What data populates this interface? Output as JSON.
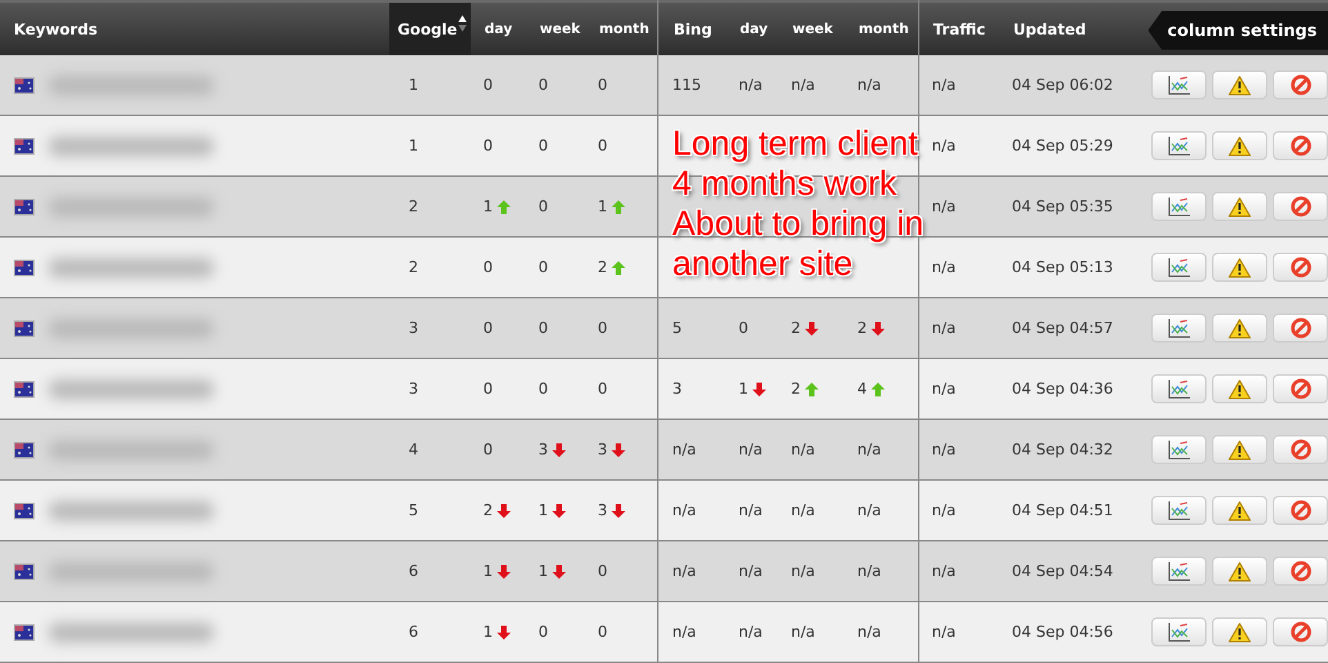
{
  "header": {
    "columns": [
      {
        "label": "Keywords",
        "selected": false
      },
      {
        "label": "Google",
        "selected": true
      },
      {
        "label": "day",
        "selected": false
      },
      {
        "label": "week",
        "selected": false
      },
      {
        "label": "month",
        "selected": false
      },
      {
        "label": "Bing",
        "selected": false
      },
      {
        "label": "day",
        "selected": false
      },
      {
        "label": "week",
        "selected": false
      },
      {
        "label": "month",
        "selected": false
      },
      {
        "label": "Traffic",
        "selected": false
      },
      {
        "label": "Updated",
        "selected": false
      }
    ],
    "settings_button": "column settings"
  },
  "rows": [
    {
      "google": "1",
      "google_changes": [
        {
          "value": "0",
          "up": false,
          "down": false
        },
        {
          "value": "0",
          "up": false,
          "down": false
        },
        {
          "value": "0",
          "up": false,
          "down": false
        }
      ],
      "bing": "115",
      "bing_changes": [
        {
          "value": "n/a",
          "up": false,
          "down": false
        },
        {
          "value": "n/a",
          "up": false,
          "down": false
        },
        {
          "value": "n/a",
          "up": false,
          "down": false
        }
      ],
      "traffic": "n/a",
      "updated": "04 Sep 06:02"
    },
    {
      "google": "1",
      "google_changes": [
        {
          "value": "0",
          "up": false,
          "down": false
        },
        {
          "value": "0",
          "up": false,
          "down": false
        },
        {
          "value": "0",
          "up": false,
          "down": false
        }
      ],
      "traffic": "n/a",
      "updated": "04 Sep 05:29"
    },
    {
      "google": "2",
      "google_changes": [
        {
          "value": "1",
          "up": true,
          "down": false
        },
        {
          "value": "0",
          "up": false,
          "down": false
        },
        {
          "value": "1",
          "up": true,
          "down": false
        }
      ],
      "traffic": "n/a",
      "updated": "04 Sep 05:35"
    },
    {
      "google": "2",
      "google_changes": [
        {
          "value": "0",
          "up": false,
          "down": false
        },
        {
          "value": "0",
          "up": false,
          "down": false
        },
        {
          "value": "2",
          "up": true,
          "down": false
        }
      ],
      "traffic": "n/a",
      "updated": "04 Sep 05:13"
    },
    {
      "google": "3",
      "google_changes": [
        {
          "value": "0",
          "up": false,
          "down": false
        },
        {
          "value": "0",
          "up": false,
          "down": false
        },
        {
          "value": "0",
          "up": false,
          "down": false
        }
      ],
      "bing": "5",
      "bing_changes": [
        {
          "value": "0",
          "up": false,
          "down": false
        },
        {
          "value": "2",
          "up": false,
          "down": true
        },
        {
          "value": "2",
          "up": false,
          "down": true
        }
      ],
      "traffic": "n/a",
      "updated": "04 Sep 04:57"
    },
    {
      "google": "3",
      "google_changes": [
        {
          "value": "0",
          "up": false,
          "down": false
        },
        {
          "value": "0",
          "up": false,
          "down": false
        },
        {
          "value": "0",
          "up": false,
          "down": false
        }
      ],
      "bing": "3",
      "bing_changes": [
        {
          "value": "1",
          "up": false,
          "down": true
        },
        {
          "value": "2",
          "up": true,
          "down": false
        },
        {
          "value": "4",
          "up": true,
          "down": false
        }
      ],
      "traffic": "n/a",
      "updated": "04 Sep 04:36"
    },
    {
      "google": "4",
      "google_changes": [
        {
          "value": "0",
          "up": false,
          "down": false
        },
        {
          "value": "3",
          "up": false,
          "down": true
        },
        {
          "value": "3",
          "up": false,
          "down": true
        }
      ],
      "bing": "n/a",
      "bing_changes": [
        {
          "value": "n/a",
          "up": false,
          "down": false
        },
        {
          "value": "n/a",
          "up": false,
          "down": false
        },
        {
          "value": "n/a",
          "up": false,
          "down": false
        }
      ],
      "traffic": "n/a",
      "updated": "04 Sep 04:32"
    },
    {
      "google": "5",
      "google_changes": [
        {
          "value": "2",
          "up": false,
          "down": true
        },
        {
          "value": "1",
          "up": false,
          "down": true
        },
        {
          "value": "3",
          "up": false,
          "down": true
        }
      ],
      "bing": "n/a",
      "bing_changes": [
        {
          "value": "n/a",
          "up": false,
          "down": false
        },
        {
          "value": "n/a",
          "up": false,
          "down": false
        },
        {
          "value": "n/a",
          "up": false,
          "down": false
        }
      ],
      "traffic": "n/a",
      "updated": "04 Sep 04:51"
    },
    {
      "google": "6",
      "google_changes": [
        {
          "value": "1",
          "up": false,
          "down": true
        },
        {
          "value": "1",
          "up": false,
          "down": true
        },
        {
          "value": "0",
          "up": false,
          "down": false
        }
      ],
      "bing": "n/a",
      "bing_changes": [
        {
          "value": "n/a",
          "up": false,
          "down": false
        },
        {
          "value": "n/a",
          "up": false,
          "down": false
        },
        {
          "value": "n/a",
          "up": false,
          "down": false
        }
      ],
      "traffic": "n/a",
      "updated": "04 Sep 04:54"
    },
    {
      "google": "6",
      "google_changes": [
        {
          "value": "1",
          "up": false,
          "down": true
        },
        {
          "value": "0",
          "up": false,
          "down": false
        },
        {
          "value": "0",
          "up": false,
          "down": false
        }
      ],
      "bing": "n/a",
      "bing_changes": [
        {
          "value": "n/a",
          "up": false,
          "down": false
        },
        {
          "value": "n/a",
          "up": false,
          "down": false
        },
        {
          "value": "n/a",
          "up": false,
          "down": false
        }
      ],
      "traffic": "n/a",
      "updated": "04 Sep 04:56"
    }
  ],
  "annotation": [
    "Long term client",
    "4 months work",
    "About to bring in",
    "another site"
  ]
}
